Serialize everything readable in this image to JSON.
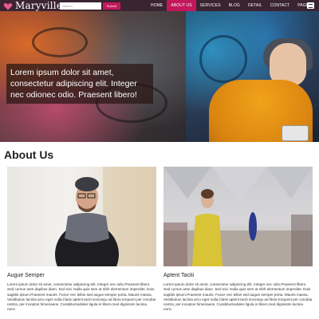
{
  "brand": {
    "name": "Maryville",
    "icon": "heart-icon",
    "accent": "#c2185b"
  },
  "search": {
    "placeholder": "Search",
    "button_label": "Submit"
  },
  "nav": {
    "background": "#3a2432",
    "items": [
      {
        "label": "HOME",
        "active": false
      },
      {
        "label": "ABOUT US",
        "active": true
      },
      {
        "label": "SERVICES",
        "active": false
      },
      {
        "label": "BLOG",
        "active": false
      },
      {
        "label": "DETAIL",
        "active": false
      },
      {
        "label": "CONTACT",
        "active": false
      },
      {
        "label": "PAGES",
        "active": false
      }
    ],
    "more_icon": "menu-icon"
  },
  "hero": {
    "caption": "Lorem ipsum dolor sit amet, consectetur adipiscing elit. Integer nec odionec odio. Praesent libero!"
  },
  "about": {
    "title": "About Us",
    "cards": [
      {
        "name": "Augue Semper",
        "text": "Lorem ipsum dolor sit amet, consectetur adipiscing elit. Integer nec odio.Praesent libero. Sed cursus ante dapibus diam. Sed nisi. Nulla quis sem at nibh elementum imperdiet. Duis sagittis ipsum.Praesent mauris. Fusce nec tellus sed augue semper porta. Mauris massa. Vestibulum lacinia arcu eget nulla.Class aptent taciti sociosqu ad litora torquent per conubia nostra, per inceptos himenaeos. Curabitursodales ligula in libero.Sed dignissim lacinia nunc."
      },
      {
        "name": "Aptent Taciti",
        "text": "Lorem ipsum dolor sit amet, consectetur adipiscing elit. Integer nec odio.Praesent libero. Sed cursus ante dapibus diam. Sed nisi. Nulla quis sem at nibh elementum imperdiet. Duis sagittis ipsum.Praesent mauris. Fusce nec tellus sed augue semper porta. Mauris massa. Vestibulum lacinia arcu eget nulla.Class aptent taciti sociosqu ad litora torquent per conubia nostra, per inceptos himenaeos. Curabitursodales ligula in libero.Sed dignissim lacinia nunc."
      }
    ]
  }
}
